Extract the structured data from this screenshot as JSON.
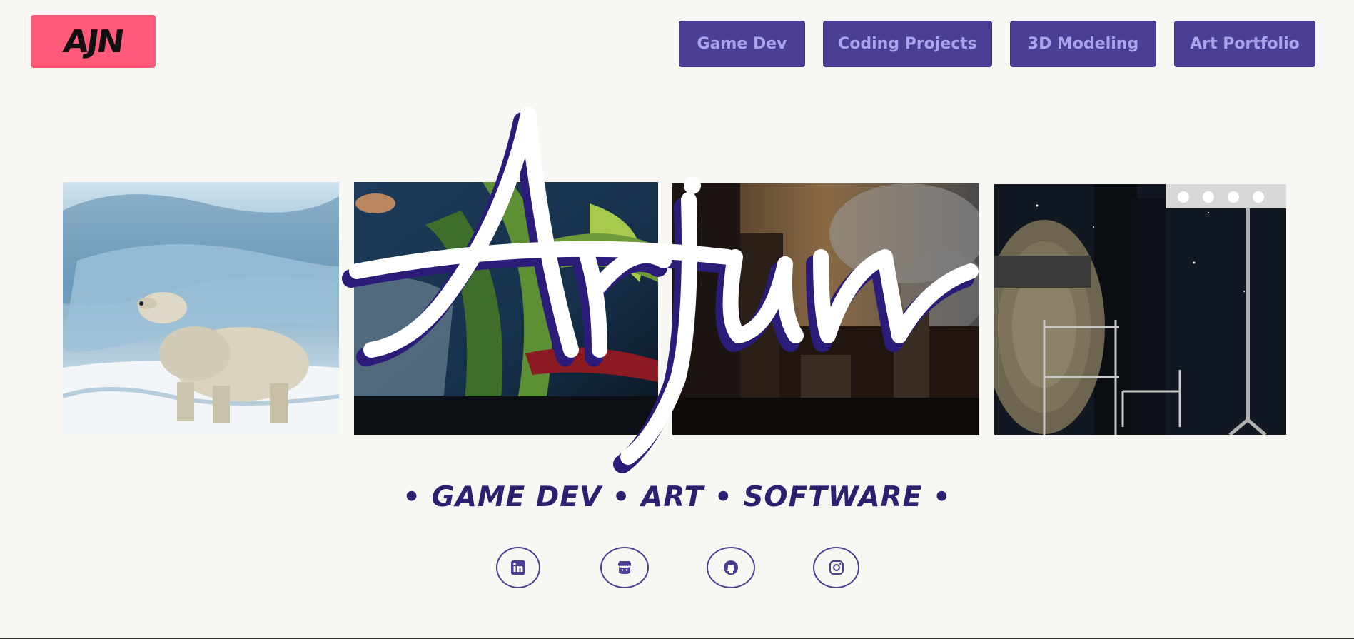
{
  "logo": {
    "text": "AJN"
  },
  "nav": [
    {
      "label": "Game Dev"
    },
    {
      "label": "Coding Projects"
    },
    {
      "label": "3D Modeling"
    },
    {
      "label": "Art Portfolio"
    }
  ],
  "hero": {
    "script_title": "Arjun",
    "tagline": "• GAME DEV • ART • SOFTWARE •"
  },
  "social": [
    {
      "icon": "linkedin-icon"
    },
    {
      "icon": "itchio-icon"
    },
    {
      "icon": "github-icon"
    },
    {
      "icon": "instagram-icon"
    }
  ],
  "colors": {
    "background": "#f9f7f4",
    "accent": "#4b3f95",
    "nav_text": "#a9a4ec",
    "logo_bg": "#ff5a7a",
    "tagline": "#2c2070"
  }
}
